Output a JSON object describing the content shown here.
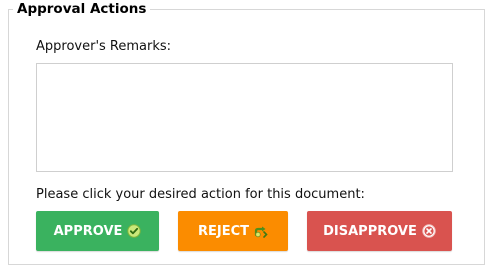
{
  "fieldset": {
    "legend": "Approval Actions"
  },
  "remarks": {
    "label": "Approver's Remarks:",
    "value": ""
  },
  "prompt": "Please click your desired action for this document:",
  "buttons": {
    "approve": {
      "label": "APPROVE",
      "icon": "check-circle-icon",
      "color": "#3ab25f"
    },
    "reject": {
      "label": "REJECT",
      "icon": "return-arrows-icon",
      "color": "#fb8c00"
    },
    "disapprove": {
      "label": "DISAPPROVE",
      "icon": "x-circle-icon",
      "color": "#d9534f"
    }
  }
}
